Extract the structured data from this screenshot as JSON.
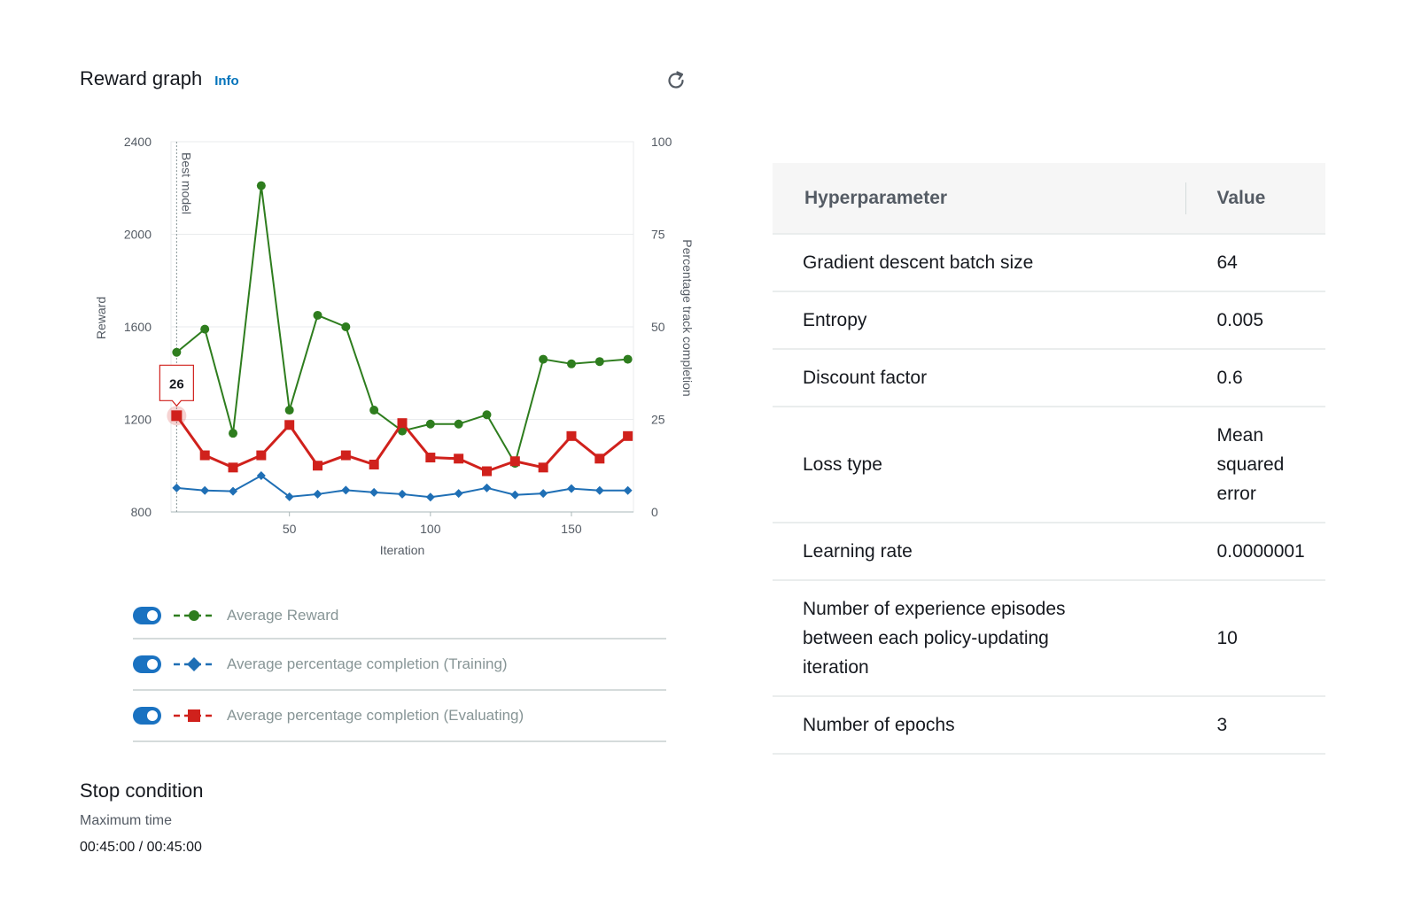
{
  "panel": {
    "title": "Reward graph",
    "info_label": "Info"
  },
  "chart_data": {
    "type": "line",
    "xlabel": "Iteration",
    "ylabel": "Reward",
    "y2label": "Percentage track completion",
    "xticks": [
      50,
      100,
      150
    ],
    "yticks": [
      800,
      1200,
      1600,
      2000,
      2400
    ],
    "y2ticks": [
      0,
      25,
      50,
      75,
      100
    ],
    "xlim": [
      8,
      172
    ],
    "ylim": [
      800,
      2400
    ],
    "y2lim": [
      0,
      100
    ],
    "grid": true,
    "x": [
      10,
      20,
      30,
      40,
      50,
      60,
      70,
      80,
      90,
      100,
      110,
      120,
      130,
      140,
      150,
      160,
      170
    ],
    "series": [
      {
        "name": "Average Reward",
        "axis": "left",
        "color": "#2e7d1e",
        "marker": "circle",
        "values": [
          1490,
          1590,
          1140,
          2210,
          1240,
          1650,
          1600,
          1240,
          1150,
          1180,
          1180,
          1220,
          1010,
          1460,
          1440,
          1450,
          1460
        ]
      },
      {
        "name": "Average percentage completion (Training)",
        "axis": "right",
        "color": "#1f6fb5",
        "marker": "diamond",
        "values": [
          6.5,
          5.8,
          5.6,
          9.8,
          4.1,
          4.8,
          5.9,
          5.3,
          4.8,
          4.0,
          5.0,
          6.5,
          4.6,
          5.0,
          6.3,
          5.8,
          5.8
        ]
      },
      {
        "name": "Average percentage completion (Evaluating)",
        "axis": "right",
        "color": "#d0211c",
        "marker": "square",
        "values": [
          26,
          15.3,
          12,
          15.3,
          23.5,
          12.5,
          15.3,
          12.8,
          24,
          14.7,
          14.4,
          11,
          13.7,
          12,
          20.5,
          14.4,
          20.5
        ]
      }
    ],
    "annotations": [
      {
        "label": "Best model",
        "x": 10
      }
    ],
    "tooltip": {
      "series": 2,
      "index": 0,
      "text": "26"
    }
  },
  "legend": [
    {
      "label": "Average Reward",
      "color": "#2e7d1e",
      "marker": "circle"
    },
    {
      "label": "Average percentage completion (Training)",
      "color": "#1f6fb5",
      "marker": "diamond"
    },
    {
      "label": "Average percentage completion (Evaluating)",
      "color": "#d0211c",
      "marker": "square"
    }
  ],
  "stop_condition": {
    "title": "Stop condition",
    "label": "Maximum time",
    "value": "00:45:00 / 00:45:00"
  },
  "hyperparameters": {
    "headers": [
      "Hyperparameter",
      "Value"
    ],
    "rows": [
      {
        "name": "Gradient descent batch size",
        "value": "64"
      },
      {
        "name": "Entropy",
        "value": "0.005"
      },
      {
        "name": "Discount factor",
        "value": "0.6"
      },
      {
        "name": "Loss type",
        "value": "Mean squared error"
      },
      {
        "name": "Learning rate",
        "value": "0.0000001"
      },
      {
        "name": "Number of experience episodes between each policy-updating iteration",
        "value": "10"
      },
      {
        "name": "Number of epochs",
        "value": "3"
      }
    ]
  },
  "icons": {
    "refresh": "refresh-icon",
    "toggle": "toggle-on"
  }
}
